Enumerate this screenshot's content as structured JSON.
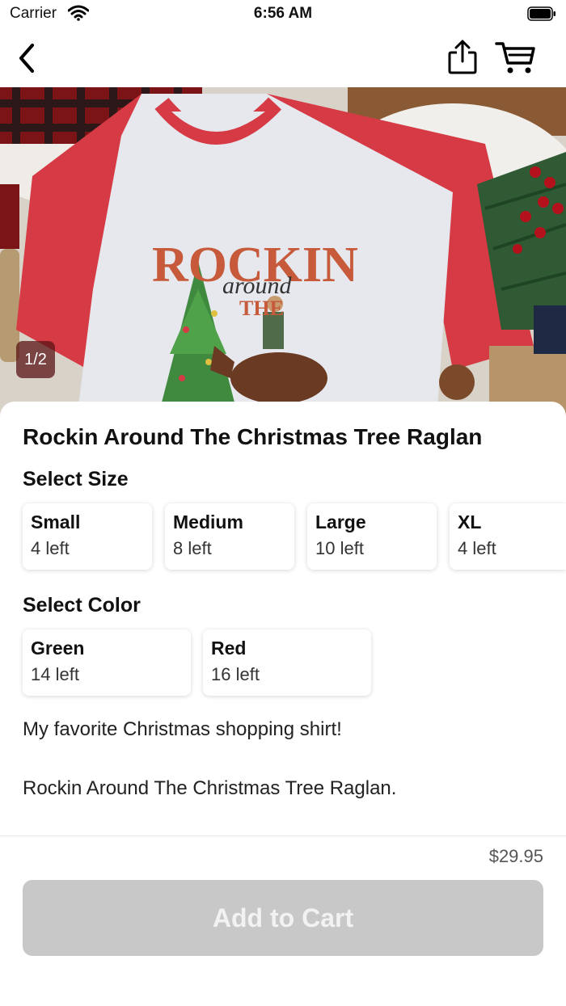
{
  "status_bar": {
    "carrier": "Carrier",
    "time": "6:56 AM"
  },
  "nav": {
    "back_icon": "chevron-left-icon",
    "share_icon": "share-icon",
    "cart_icon": "cart-icon"
  },
  "gallery": {
    "page_indicator": "1/2",
    "shirt_print": {
      "line1": "ROCKIN",
      "line2": "around",
      "line3": "THE"
    }
  },
  "product": {
    "title": "Rockin Around The Christmas Tree Raglan",
    "size_section_label": "Select Size",
    "sizes": [
      {
        "name": "Small",
        "stock": "4 left"
      },
      {
        "name": "Medium",
        "stock": "8 left"
      },
      {
        "name": "Large",
        "stock": "10 left"
      },
      {
        "name": "XL",
        "stock": "4 left"
      }
    ],
    "color_section_label": "Select Color",
    "colors": [
      {
        "name": "Green",
        "stock": "14 left"
      },
      {
        "name": "Red",
        "stock": "16 left"
      }
    ],
    "description_line1": "My favorite Christmas shopping shirt!",
    "description_line2": "Rockin Around The Christmas Tree Raglan."
  },
  "footer": {
    "price": "$29.95",
    "add_to_cart_label": "Add to Cart"
  },
  "colors": {
    "shirt_red": "#d63a44",
    "shirt_body": "#e6e8ee",
    "button_disabled": "#c8c8c8"
  }
}
